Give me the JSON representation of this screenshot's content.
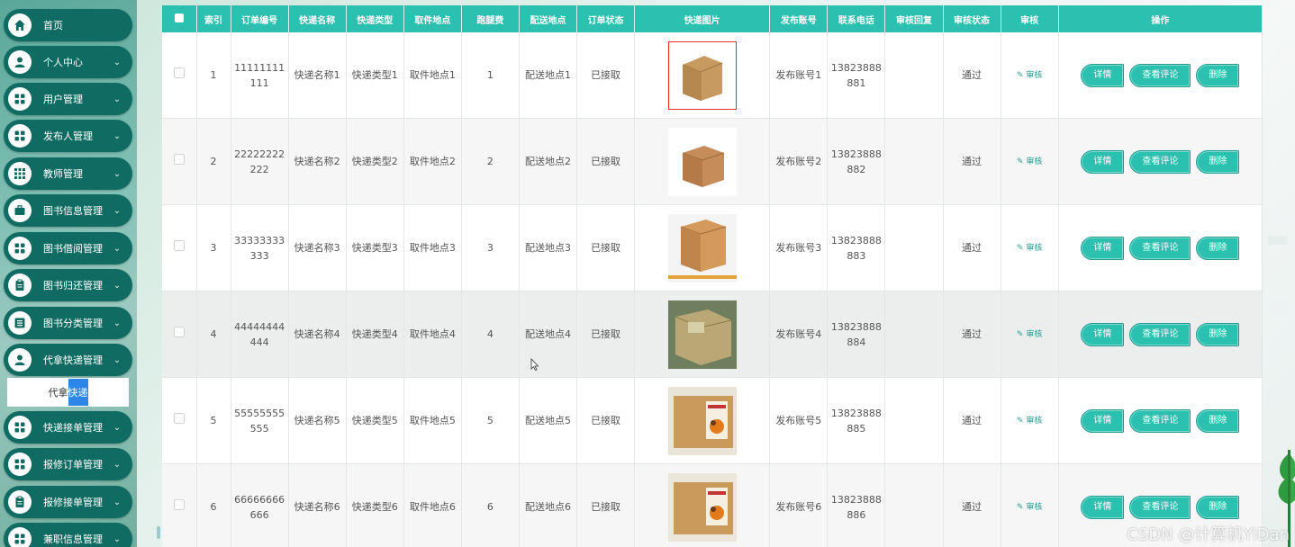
{
  "sidebar": {
    "items": [
      {
        "label": "首页",
        "icon": "home-icon",
        "expandable": false
      },
      {
        "label": "个人中心",
        "icon": "user-icon",
        "expandable": true
      },
      {
        "label": "用户管理",
        "icon": "grid-icon",
        "expandable": true
      },
      {
        "label": "发布人管理",
        "icon": "grid-icon",
        "expandable": true
      },
      {
        "label": "教师管理",
        "icon": "apps-icon",
        "expandable": true
      },
      {
        "label": "图书信息管理",
        "icon": "briefcase-icon",
        "expandable": true
      },
      {
        "label": "图书借阅管理",
        "icon": "grid-icon",
        "expandable": true
      },
      {
        "label": "图书归还管理",
        "icon": "clipboard-icon",
        "expandable": true
      },
      {
        "label": "图书分类管理",
        "icon": "list-icon",
        "expandable": true
      },
      {
        "label": "代拿快递管理",
        "icon": "user-icon",
        "expandable": true
      }
    ],
    "submenu": {
      "label_before": "代拿",
      "label_highlight": "快递"
    },
    "items_after": [
      {
        "label": "快递接单管理",
        "icon": "grid-icon",
        "expandable": true
      },
      {
        "label": "报修订单管理",
        "icon": "grid-icon",
        "expandable": true
      },
      {
        "label": "报修接单管理",
        "icon": "clipboard-icon",
        "expandable": true
      },
      {
        "label": "兼职信息管理",
        "icon": "grid-icon",
        "expandable": true
      }
    ]
  },
  "table": {
    "headers": [
      "索引",
      "订单编号",
      "快递名称",
      "快递类型",
      "取件地点",
      "跑腿费",
      "配送地点",
      "订单状态",
      "快递图片",
      "发布账号",
      "联系电话",
      "审核回复",
      "审核状态",
      "审核",
      "操作"
    ],
    "rows": [
      {
        "index": "1",
        "order_no": "11111111111",
        "name": "快递名称1",
        "type": "快递类型1",
        "pickup": "取件地点1",
        "fee": "1",
        "delivery": "配送地点1",
        "status": "已接取",
        "image": "box-photo-1",
        "account": "发布账号1",
        "phone": "13823888881",
        "reply": "",
        "audit_status": "通过"
      },
      {
        "index": "2",
        "order_no": "22222222222",
        "name": "快递名称2",
        "type": "快递类型2",
        "pickup": "取件地点2",
        "fee": "2",
        "delivery": "配送地点2",
        "status": "已接取",
        "image": "box-photo-2",
        "account": "发布账号2",
        "phone": "13823888882",
        "reply": "",
        "audit_status": "通过"
      },
      {
        "index": "3",
        "order_no": "33333333333",
        "name": "快递名称3",
        "type": "快递类型3",
        "pickup": "取件地点3",
        "fee": "3",
        "delivery": "配送地点3",
        "status": "已接取",
        "image": "box-photo-3",
        "account": "发布账号3",
        "phone": "13823888883",
        "reply": "",
        "audit_status": "通过"
      },
      {
        "index": "4",
        "order_no": "44444444444",
        "name": "快递名称4",
        "type": "快递类型4",
        "pickup": "取件地点4",
        "fee": "4",
        "delivery": "配送地点4",
        "status": "已接取",
        "image": "box-photo-4",
        "account": "发布账号4",
        "phone": "13823888884",
        "reply": "",
        "audit_status": "通过"
      },
      {
        "index": "5",
        "order_no": "55555555555",
        "name": "快递名称5",
        "type": "快递类型5",
        "pickup": "取件地点5",
        "fee": "5",
        "delivery": "配送地点5",
        "status": "已接取",
        "image": "box-photo-5",
        "account": "发布账号5",
        "phone": "13823888885",
        "reply": "",
        "audit_status": "通过"
      },
      {
        "index": "6",
        "order_no": "66666666666",
        "name": "快递名称6",
        "type": "快递类型6",
        "pickup": "取件地点6",
        "fee": "6",
        "delivery": "配送地点6",
        "status": "已接取",
        "image": "box-photo-6",
        "account": "发布账号6",
        "phone": "13823888886",
        "reply": "",
        "audit_status": "通过"
      }
    ],
    "audit_link_label": "审核",
    "actions": {
      "detail": "详情",
      "review": "查看评论",
      "delete": "删除"
    }
  },
  "watermark": "CSDN @计算机YiDan",
  "colors": {
    "sidebar_item": "#106c63",
    "header": "#2bc0b0",
    "button": "#2bc0b0"
  }
}
